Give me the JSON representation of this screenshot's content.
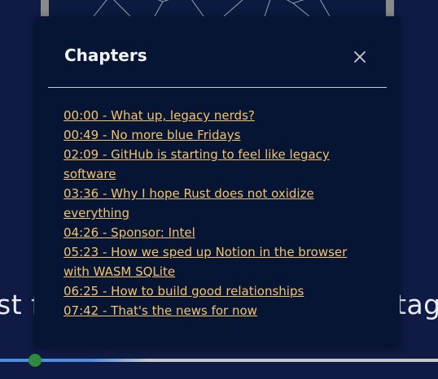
{
  "background": {
    "title_left": "st f",
    "title_right": "tage"
  },
  "player": {
    "progress_fraction": 0.08,
    "knob_color": "#2e8b3c",
    "fill_color": "#4a8fe0"
  },
  "chapters_modal": {
    "title": "Chapters",
    "close_icon": "close-icon",
    "items": [
      "00:00 - What up, legacy nerds?",
      "00:49 - No more blue Fridays",
      "02:09 - GitHub is starting to feel like legacy software",
      "03:36 - Why I hope Rust does not oxidize everything",
      "04:26 - Sponsor: Intel",
      "05:23 - How we sped up Notion in the browser with WASM SQLite",
      "06:25 - How to build good relationships",
      "07:42 - That's the news for now"
    ]
  },
  "colors": {
    "page_background": "#0f1b44",
    "modal_background": "#071534",
    "link": "#f5c36b",
    "title_text": "#f2f4f8"
  }
}
